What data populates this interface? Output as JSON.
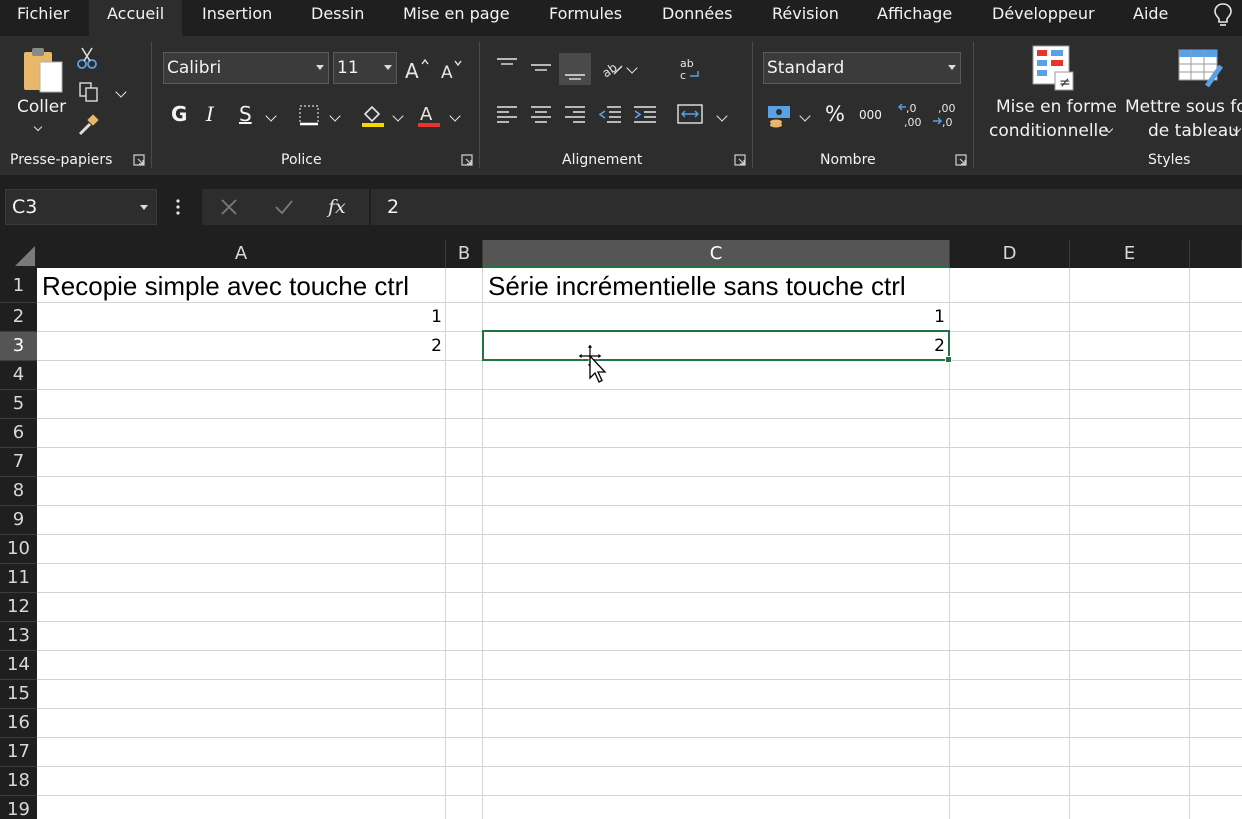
{
  "tabs": {
    "file": "Fichier",
    "home": "Accueil",
    "insert": "Insertion",
    "draw": "Dessin",
    "page_layout": "Mise en page",
    "formulas": "Formules",
    "data": "Données",
    "review": "Révision",
    "view": "Affichage",
    "developer": "Développeur",
    "help": "Aide",
    "active": "Accueil"
  },
  "ribbon": {
    "clipboard": {
      "paste_label": "Coller",
      "group_label": "Presse-papiers"
    },
    "font": {
      "name": "Calibri",
      "size": "11",
      "bold": "G",
      "italic": "I",
      "underline": "S",
      "group_label": "Police"
    },
    "alignment": {
      "group_label": "Alignement"
    },
    "number": {
      "format": "Standard",
      "percent": "%",
      "thousands": "000",
      "group_label": "Nombre"
    },
    "styles": {
      "conditional_line1": "Mise en forme",
      "conditional_line2": "conditionnelle",
      "table_line1": "Mettre sous fo",
      "table_line2": "de tableau",
      "group_label": "Styles"
    }
  },
  "formula_bar": {
    "name_box": "C3",
    "value": "2"
  },
  "grid": {
    "columns": [
      "A",
      "B",
      "C",
      "D",
      "E"
    ],
    "selected_column": "C",
    "rows": [
      "1",
      "2",
      "3",
      "4",
      "5",
      "6",
      "7",
      "8",
      "9",
      "10",
      "11",
      "12",
      "13",
      "14",
      "15",
      "16",
      "17",
      "18",
      "19"
    ],
    "selected_row": "3",
    "cells": {
      "A1": "Recopie simple avec touche ctrl",
      "A2": "1",
      "A3": "2",
      "C1": "Série incrémentielle sans touche ctrl",
      "C2": "1",
      "C3": "2"
    },
    "active_cell": "C3"
  },
  "colors": {
    "selection": "#217346",
    "ribbon_bg": "#2d2d2d",
    "tab_bg": "#1f1f1f"
  }
}
